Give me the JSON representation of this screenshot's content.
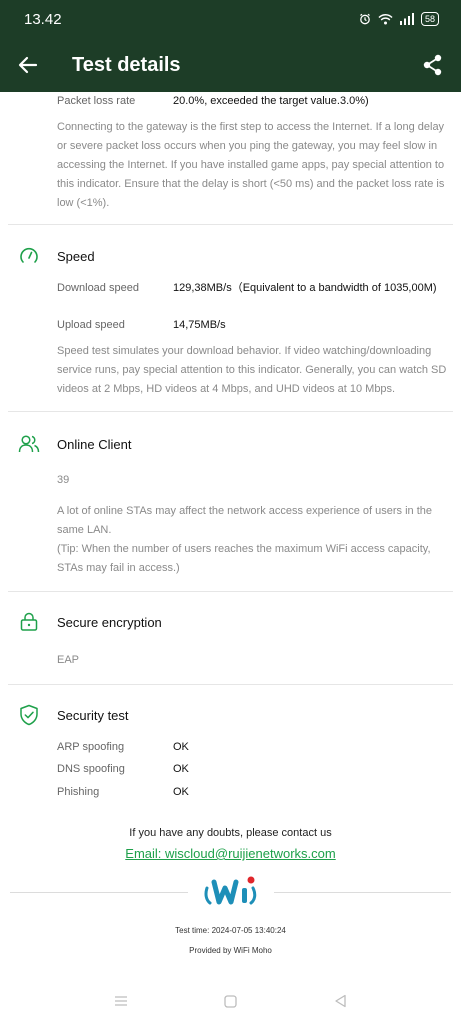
{
  "status_bar": {
    "time": "13.42",
    "battery": "58"
  },
  "header": {
    "title": "Test details"
  },
  "gateway": {
    "packet_loss_label": "Packet loss rate",
    "packet_loss_value": "20.0%, exceeded the target value.3.0%)",
    "description": "Connecting to the gateway is the first step to access the Internet. If a long delay or severe packet loss occurs when you ping the gateway, you may feel slow in accessing the Internet. If you have installed game apps, pay special attention to this indicator. Ensure that the delay is short (<50 ms) and the packet loss rate is low (<1%)."
  },
  "speed": {
    "title": "Speed",
    "download_label": "Download speed",
    "download_value": "129,38MB/s（Equivalent to a bandwidth of 1035,00M)",
    "upload_label": "Upload speed",
    "upload_value": "14,75MB/s",
    "description": "Speed test simulates your download behavior. If video watching/downloading service runs, pay special attention to this indicator. Generally, you can watch SD videos at 2 Mbps, HD videos at 4 Mbps, and UHD videos at 10 Mbps."
  },
  "online_client": {
    "title": "Online Client",
    "count": "39",
    "description_1": "A lot of online STAs may affect the network access experience of users in the same LAN.",
    "description_2": "(Tip: When the number of users reaches the maximum WiFi access capacity, STAs may fail in access.)"
  },
  "secure_encryption": {
    "title": "Secure encryption",
    "value": "EAP"
  },
  "security_test": {
    "title": "Security test",
    "items": [
      {
        "label": "ARP spoofing",
        "value": "OK"
      },
      {
        "label": "DNS spoofing",
        "value": "OK"
      },
      {
        "label": "Phishing",
        "value": "OK"
      }
    ]
  },
  "contact": {
    "text": "If you have any doubts, please contact us",
    "email": "Email: wiscloud@ruijienetworks.com"
  },
  "footer": {
    "test_time": "Test time: 2024-07-05 13:40:24",
    "provided_by": "Provided by WiFi Moho"
  },
  "colors": {
    "header_bg": "#1d3d27",
    "accent": "#1ea04a",
    "logo_blue": "#1e8fb8",
    "logo_red": "#e0262b"
  }
}
